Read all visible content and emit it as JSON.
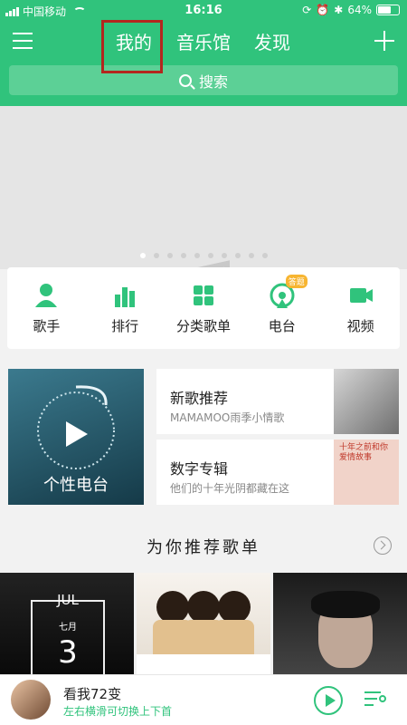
{
  "status": {
    "carrier": "中国移动",
    "time": "16:16",
    "battery": "64%",
    "battery_level": 0.64
  },
  "header": {
    "tabs": [
      {
        "label": "我的"
      },
      {
        "label": "音乐馆"
      },
      {
        "label": "发现"
      }
    ],
    "selected_tab": "我的"
  },
  "search": {
    "placeholder": "搜索"
  },
  "banner": {
    "page_count": 10,
    "active_index": 0
  },
  "categories": [
    {
      "label": "歌手",
      "icon": "singer-icon"
    },
    {
      "label": "排行",
      "icon": "chart-bars-icon"
    },
    {
      "label": "分类歌单",
      "icon": "grid-icon"
    },
    {
      "label": "电台",
      "icon": "radio-icon",
      "badge": "答题"
    },
    {
      "label": "视频",
      "icon": "video-icon"
    }
  ],
  "radio": {
    "label": "个性电台"
  },
  "recommend": [
    {
      "title": "新歌推荐",
      "subtitle": "MAMAMOO雨季小情歌"
    },
    {
      "title": "数字专辑",
      "subtitle": "他们的十年光阴都藏在这"
    }
  ],
  "playlists": {
    "title": "为你推荐歌单",
    "calendar": {
      "month": "JUL",
      "chinese_month": "七月",
      "day": "3"
    }
  },
  "album_art_text": "十年之前和你爱情故事",
  "player": {
    "song": "看我72变",
    "hint": "左右横滑可切换上下首"
  },
  "colors": {
    "brand": "#30c37c",
    "highlight": "#b3261e"
  }
}
